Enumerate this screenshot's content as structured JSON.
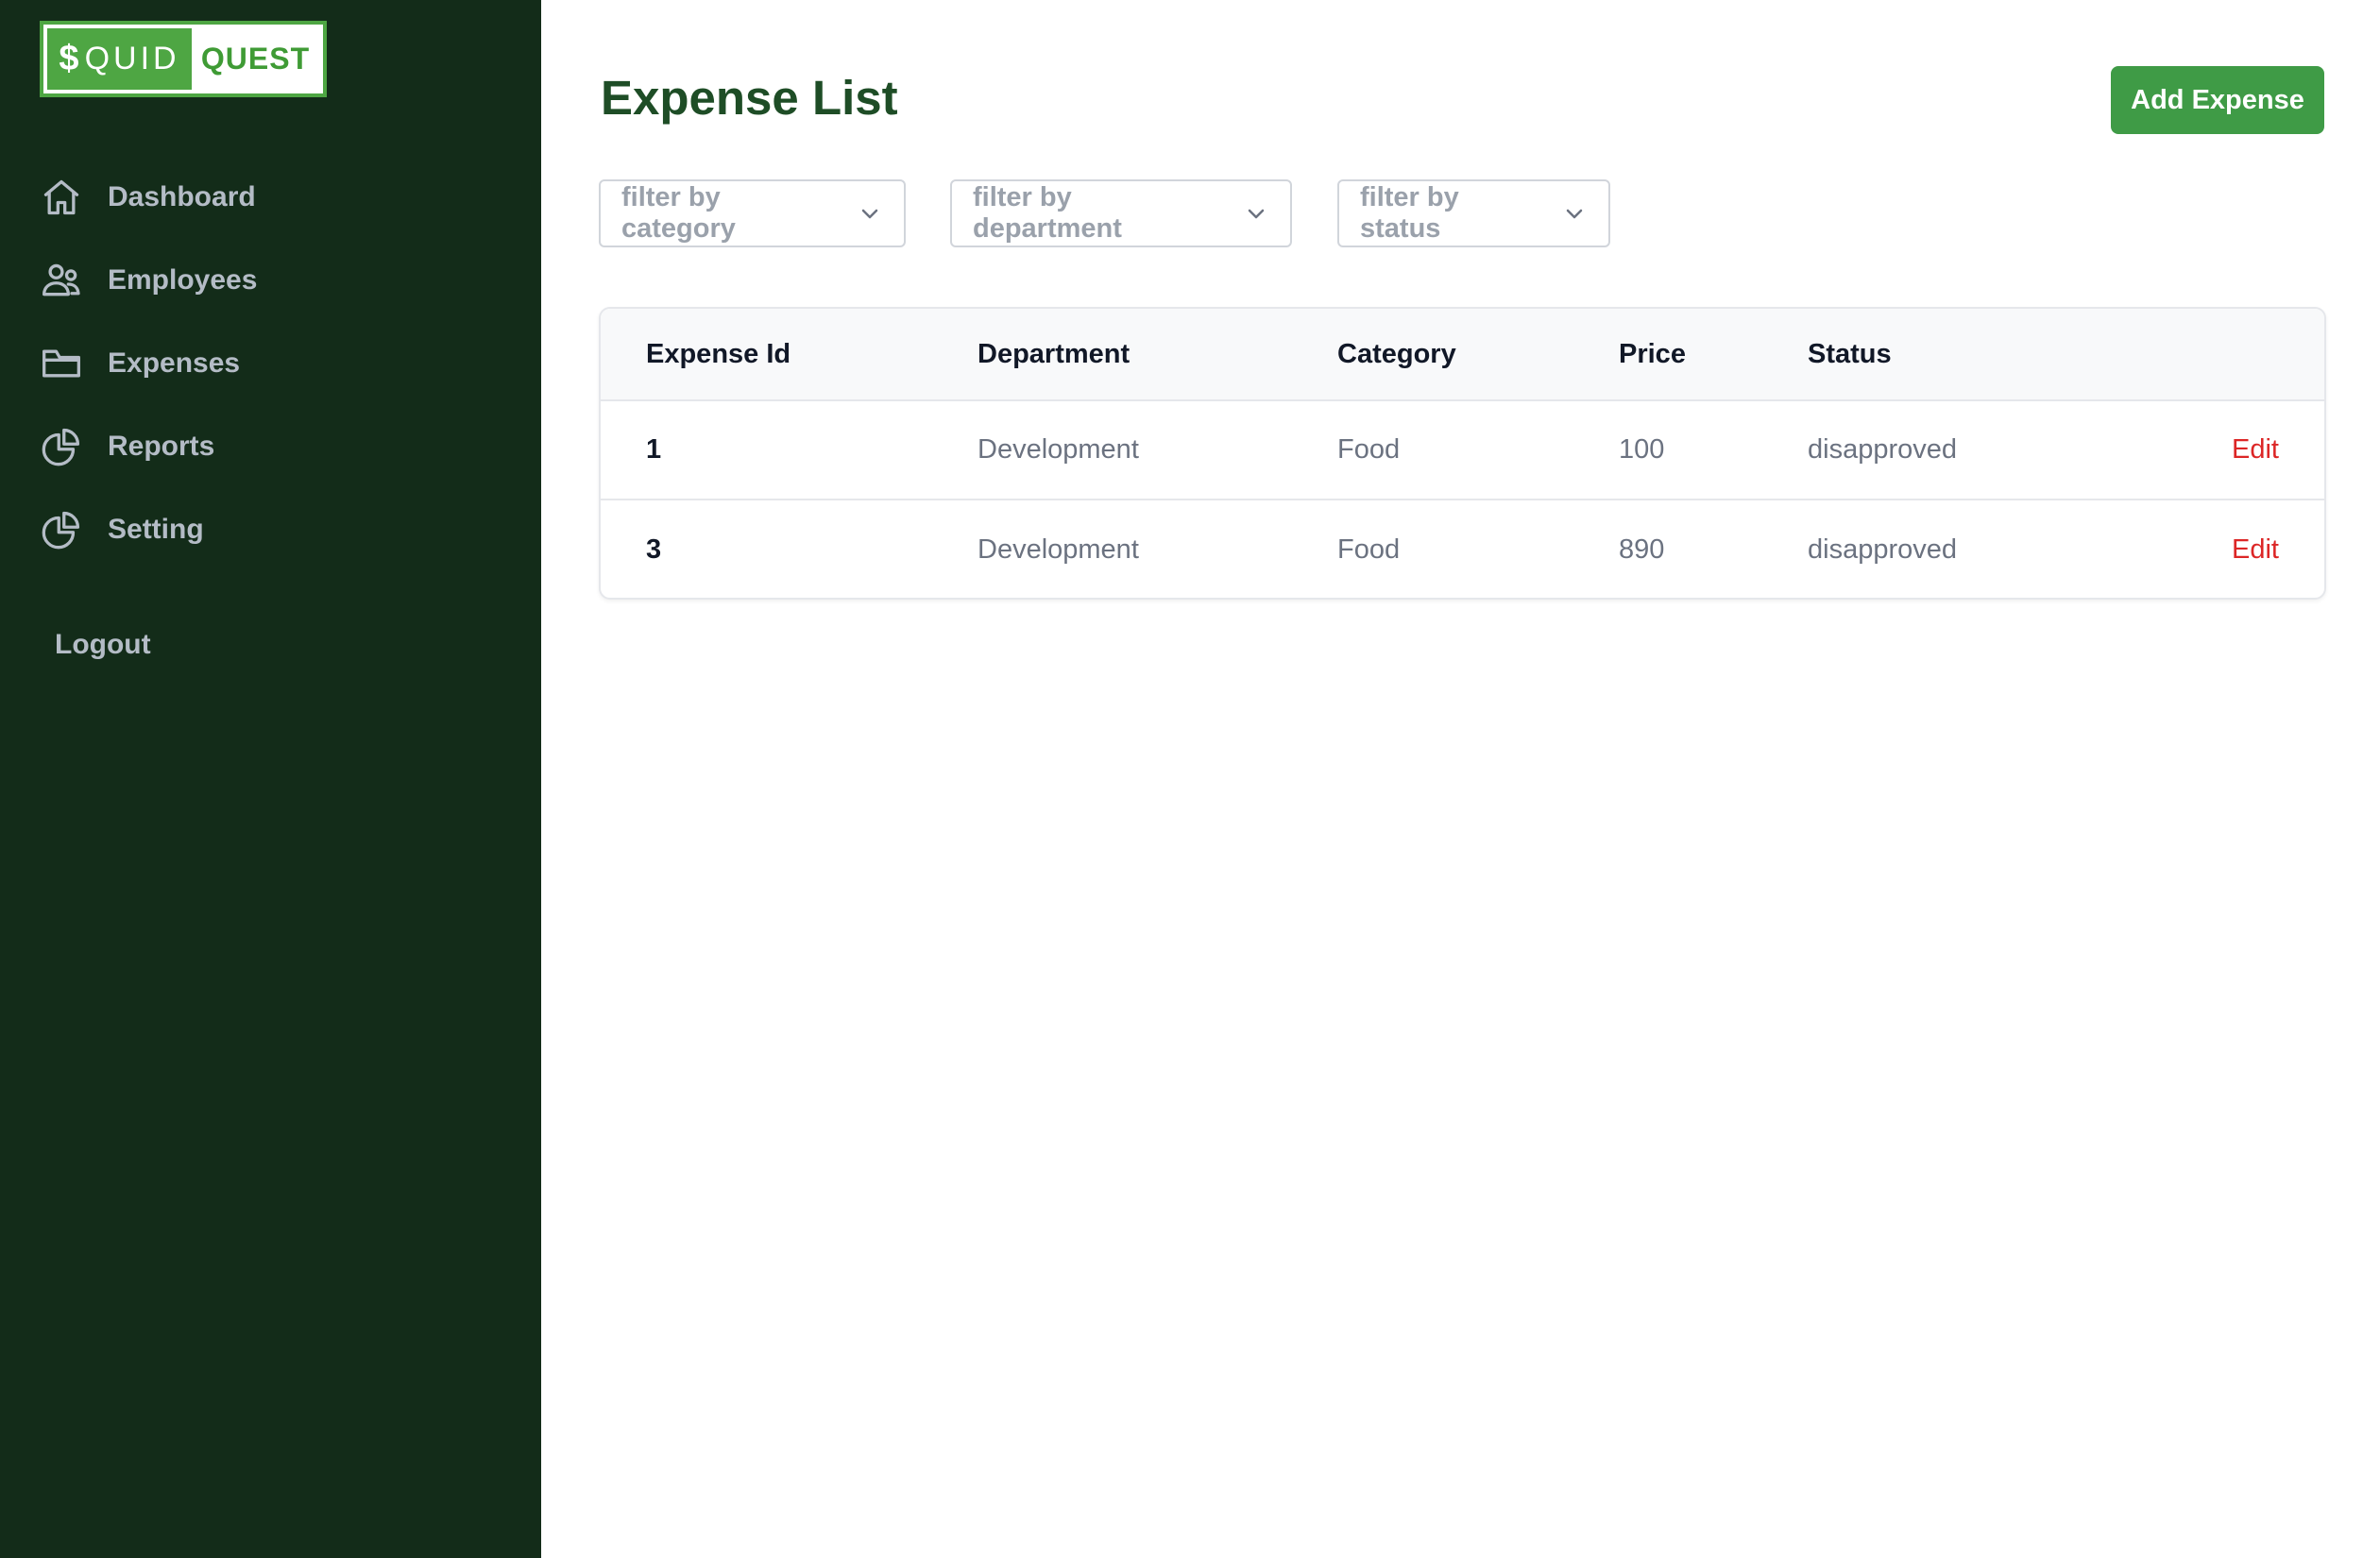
{
  "sidebar": {
    "logo": {
      "left": "QUID",
      "dollar": "$",
      "right": "QUEST"
    },
    "items": [
      {
        "label": "Dashboard",
        "icon": "home-icon"
      },
      {
        "label": "Employees",
        "icon": "users-icon"
      },
      {
        "label": "Expenses",
        "icon": "folder-icon"
      },
      {
        "label": "Reports",
        "icon": "pie-chart-icon"
      },
      {
        "label": "Setting",
        "icon": "pie-chart-icon"
      }
    ],
    "logout": "Logout"
  },
  "main": {
    "title": "Expense List",
    "add_button": "Add Expense",
    "filters": {
      "category": "filter by category",
      "department": "filter by department",
      "status": "filter by status"
    },
    "table": {
      "headers": [
        "Expense Id",
        "Department",
        "Category",
        "Price",
        "Status"
      ],
      "rows": [
        {
          "id": "1",
          "department": "Development",
          "category": "Food",
          "price": "100",
          "status": "disapproved",
          "action": "Edit"
        },
        {
          "id": "3",
          "department": "Development",
          "category": "Food",
          "price": "890",
          "status": "disapproved",
          "action": "Edit"
        }
      ]
    }
  },
  "colors": {
    "sidebar_bg": "#132c19",
    "brand_green": "#3f9b46",
    "title_green": "#1e4d26",
    "edit_red": "#dc2626"
  }
}
